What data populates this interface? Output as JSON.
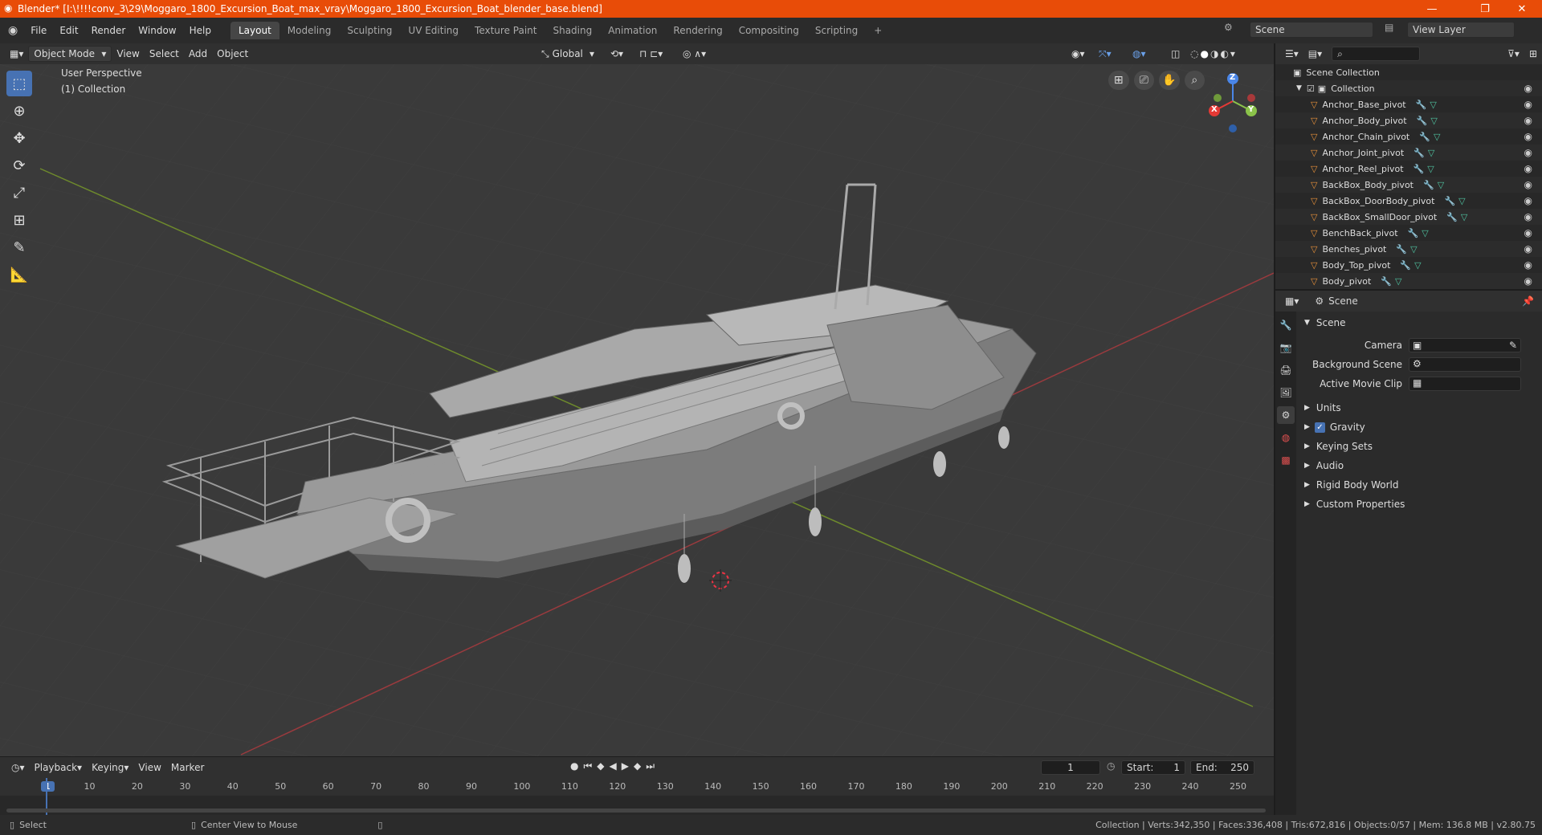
{
  "window": {
    "title": "Blender* [I:\\!!!!conv_3\\29\\Moggaro_1800_Excursion_Boat_max_vray\\Moggaro_1800_Excursion_Boat_blender_base.blend]",
    "minimize": "—",
    "maximize": "❐",
    "close": "✕"
  },
  "menu": {
    "items": [
      "File",
      "Edit",
      "Render",
      "Window",
      "Help"
    ],
    "workspaces": [
      "Layout",
      "Modeling",
      "Sculpting",
      "UV Editing",
      "Texture Paint",
      "Shading",
      "Animation",
      "Rendering",
      "Compositing",
      "Scripting"
    ],
    "add_tab": "+",
    "scene_name": "Scene",
    "view_layer": "View Layer"
  },
  "viewport": {
    "mode": "Object Mode",
    "menus": [
      "View",
      "Select",
      "Add",
      "Object"
    ],
    "orientation": "Global",
    "perspective_label": "User Perspective",
    "collection_label": "(1) Collection",
    "gizmo": {
      "z": "Z",
      "y": "Y",
      "x": "X"
    }
  },
  "outliner": {
    "root": "Scene Collection",
    "collection": "Collection",
    "items": [
      "Anchor_Base_pivot",
      "Anchor_Body_pivot",
      "Anchor_Chain_pivot",
      "Anchor_Joint_pivot",
      "Anchor_Reel_pivot",
      "BackBox_Body_pivot",
      "BackBox_DoorBody_pivot",
      "BackBox_SmallDoor_pivot",
      "BenchBack_pivot",
      "Benches_pivot",
      "Body_Top_pivot",
      "Body_pivot"
    ]
  },
  "properties": {
    "context": "Scene",
    "panel_title": "Scene",
    "fields": [
      {
        "label": "Camera"
      },
      {
        "label": "Background Scene"
      },
      {
        "label": "Active Movie Clip"
      }
    ],
    "sections": [
      "Units",
      "Gravity",
      "Keying Sets",
      "Audio",
      "Rigid Body World",
      "Custom Properties"
    ],
    "gravity_checked": true
  },
  "timeline": {
    "menus": [
      "Playback",
      "Keying",
      "View",
      "Marker"
    ],
    "current_frame": "1",
    "start_label": "Start:",
    "start": "1",
    "end_label": "End:",
    "end": "250",
    "ticks": [
      "1",
      "10",
      "20",
      "30",
      "40",
      "50",
      "60",
      "70",
      "80",
      "90",
      "100",
      "110",
      "120",
      "130",
      "140",
      "150",
      "160",
      "170",
      "180",
      "190",
      "200",
      "210",
      "220",
      "230",
      "240",
      "250"
    ]
  },
  "status": {
    "select": "Select",
    "center": "Center View to Mouse",
    "stats": "Collection | Verts:342,350 | Faces:336,408 | Tris:672,816 | Objects:0/57 | Mem: 136.8 MB | v2.80.75"
  }
}
